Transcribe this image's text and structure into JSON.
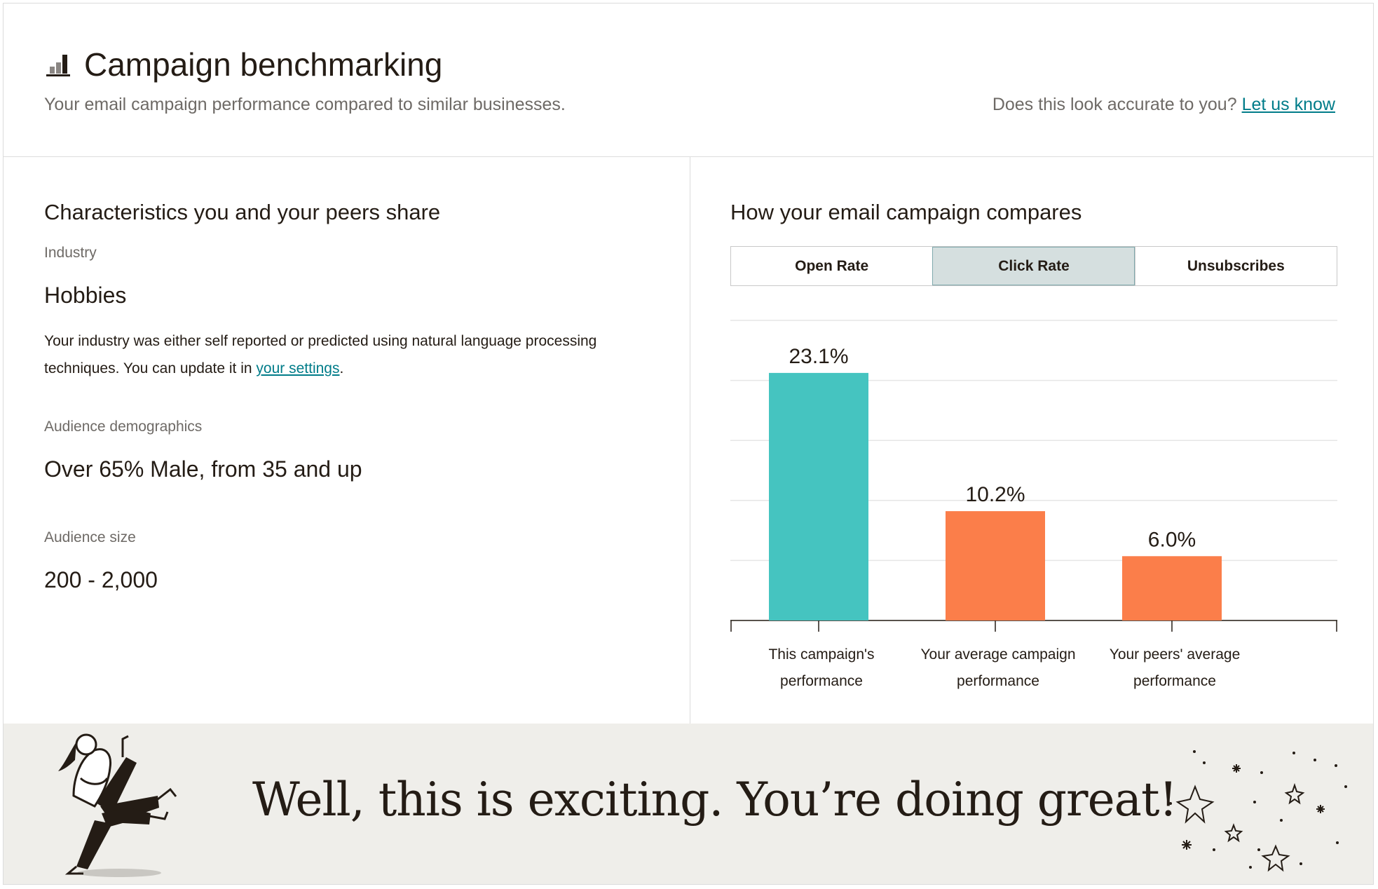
{
  "header": {
    "title": "Campaign benchmarking",
    "subtitle": "Your email campaign performance compared to similar businesses.",
    "feedback_prompt": "Does this look accurate to you?",
    "feedback_link": "Let us know",
    "icon": "bar-chart-icon"
  },
  "characteristics": {
    "heading": "Characteristics you and your peers share",
    "industry_label": "Industry",
    "industry_value": "Hobbies",
    "industry_note": "Your industry was either self reported or predicted using natural language processing techniques. You can update it in ",
    "industry_note_link": "your settings",
    "industry_note_end": ".",
    "demographics_label": "Audience demographics",
    "demographics_value": "Over 65% Male, from 35 and up",
    "size_label": "Audience size",
    "size_value": "200 - 2,000"
  },
  "comparison": {
    "heading": "How your email campaign compares",
    "tabs": [
      "Open Rate",
      "Click Rate",
      "Unsubscribes"
    ],
    "active_tab": "Click Rate"
  },
  "chart_data": {
    "type": "bar",
    "categories": [
      [
        "This campaign's",
        "performance"
      ],
      [
        "Your average campaign",
        "performance"
      ],
      [
        "Your peers' average",
        "performance"
      ]
    ],
    "values": [
      23.1,
      10.2,
      6.0
    ],
    "data_labels": [
      "23.1%",
      "10.2%",
      "6.0%"
    ],
    "colors": [
      "#45c4c0",
      "#fb7e4a",
      "#fb7e4a"
    ],
    "ylim": [
      0,
      28
    ],
    "grid": true
  },
  "banner": {
    "message": "Well, this is exciting. You’re doing great!"
  },
  "colors": {
    "accent_link": "#007c89",
    "banner_bg": "#efeeea",
    "active_tab_bg": "#d5dfdf"
  }
}
